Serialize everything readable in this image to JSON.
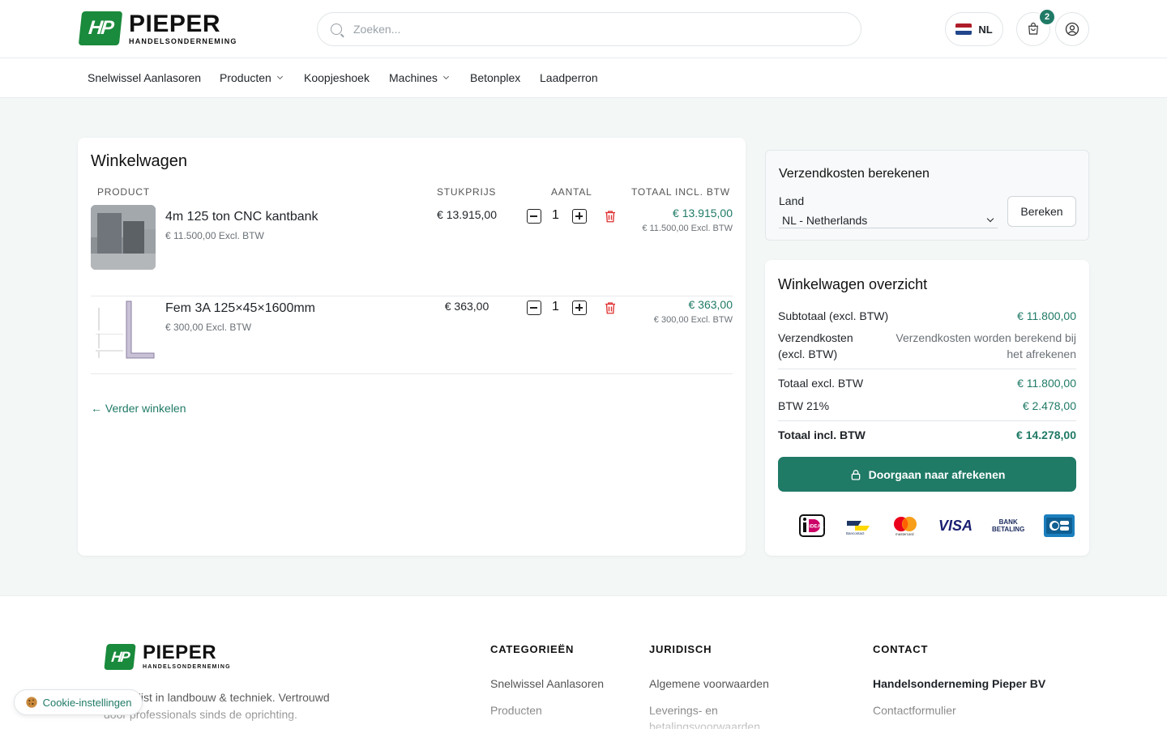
{
  "brand": {
    "name": "PIEPER",
    "tagline": "HANDELSONDERNEMING",
    "mark": "HP",
    "color": "#1a8a3c"
  },
  "search": {
    "placeholder": "Zoeken..."
  },
  "header": {
    "lang": "NL",
    "cart_count": "2"
  },
  "nav": [
    "Snelwissel Aanlasoren",
    "Producten",
    "Koopjeshoek",
    "Machines",
    "Betonplex",
    "Laadperron"
  ],
  "cart": {
    "title": "Winkelwagen",
    "columns": {
      "product": "PRODUCT",
      "unit": "STUKPRIJS",
      "qty": "AANTAL",
      "total": "TOTAAL INCL. BTW"
    },
    "items": [
      {
        "name": "4m 125 ton CNC kantbank",
        "excl": "€ 11.500,00 Excl. BTW",
        "unit": "€ 13.915,00",
        "qty": "1",
        "total": "€ 13.915,00",
        "total_excl": "€ 11.500,00 Excl. BTW"
      },
      {
        "name": "Fem 3A 125×45×1600mm",
        "excl": "€ 300,00 Excl. BTW",
        "unit": "€ 363,00",
        "qty": "1",
        "total": "€ 363,00",
        "total_excl": "€ 300,00 Excl. BTW"
      }
    ],
    "continue": "← Verder winkelen"
  },
  "shipping": {
    "title": "Verzendkosten berekenen",
    "country_label": "Land",
    "country_value": "NL - Netherlands",
    "button": "Bereken"
  },
  "overview": {
    "title": "Winkelwagen overzicht",
    "subtotal_label": "Subtotaal (excl. BTW)",
    "subtotal": "€ 11.800,00",
    "shipping_label": "Verzendkosten (excl. BTW)",
    "shipping_note": "Verzendkosten worden berekend bij het afrekenen",
    "total_excl_label": "Totaal excl. BTW",
    "total_excl": "€ 11.800,00",
    "vat_label": "BTW 21%",
    "vat": "€ 2.478,00",
    "total_incl_label": "Totaal incl. BTW",
    "total_incl": "€ 14.278,00",
    "checkout": "Doorgaan naar afrekenen",
    "payments": {
      "bancontact": "Bancontact",
      "mastercard": "mastercard",
      "visa": "VISA",
      "bank": "BANK",
      "betaling": "BETALING",
      "ideal": "iDEAL"
    }
  },
  "footer": {
    "description": "Specialist in landbouw & techniek. Vertrouwd door professionals sinds de oprichting.",
    "cat_title": "CATEGORIEËN",
    "cat_links": [
      "Snelwissel Aanlasoren",
      "Producten"
    ],
    "legal_title": "JURIDISCH",
    "legal_links": [
      "Algemene voorwaarden",
      "Leverings- en betalingsvoorwaarden"
    ],
    "contact_title": "CONTACT",
    "company": "Handelsonderneming Pieper BV",
    "contact_link": "Contactformulier"
  },
  "cookie": "Cookie-instellingen",
  "colors": {
    "accent": "#1f7a66",
    "danger": "#e03131"
  }
}
